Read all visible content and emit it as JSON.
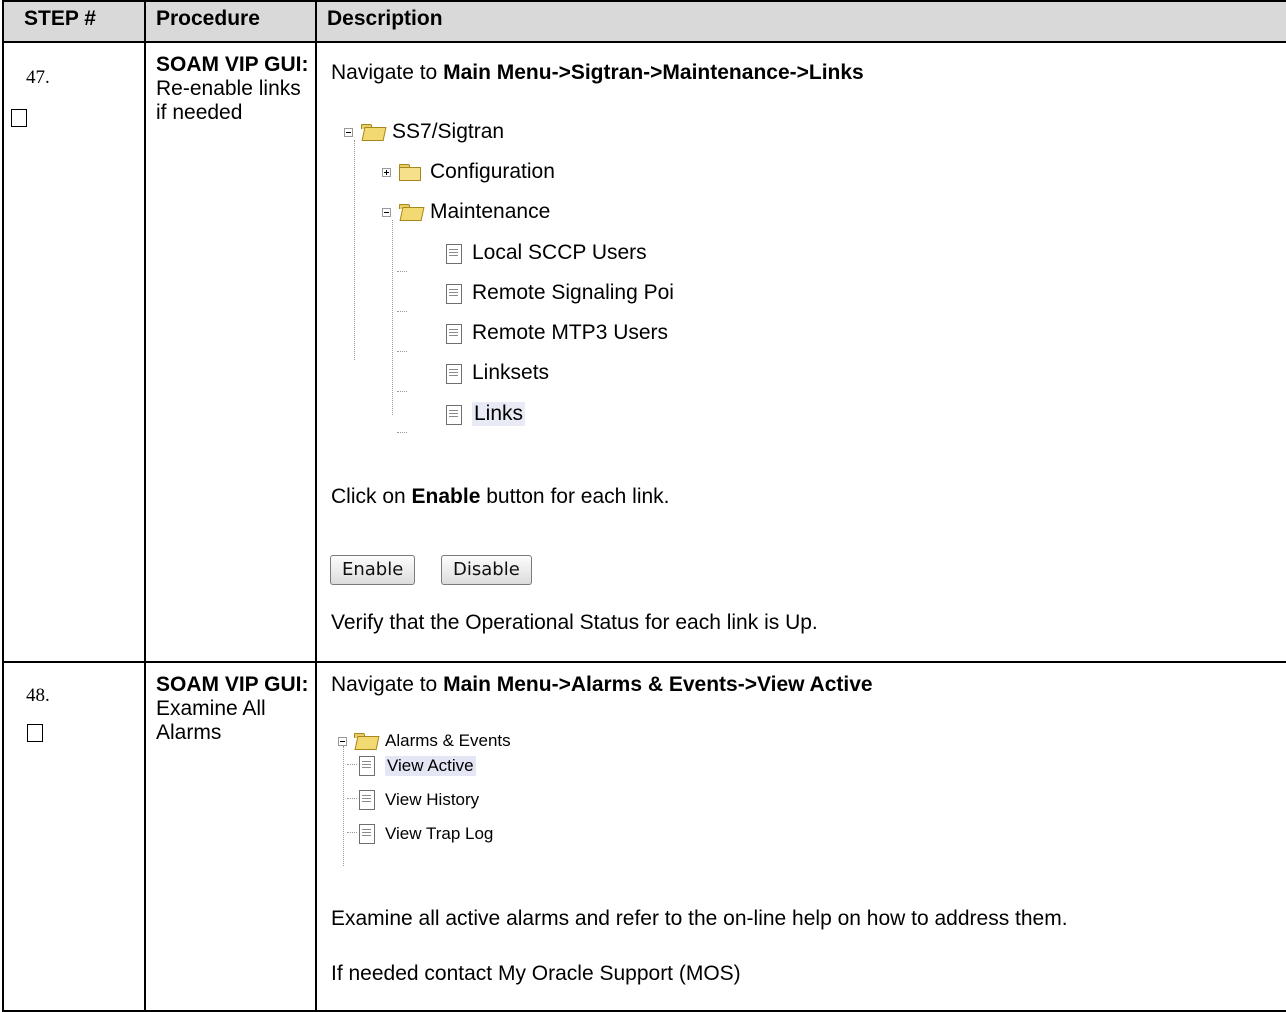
{
  "headers": {
    "step": "STEP #",
    "procedure": "Procedure",
    "description": "Description"
  },
  "step47": {
    "number": "47.",
    "procedure_bold": "SOAM VIP GUI:",
    "procedure_text": "Re-enable links if needed",
    "nav_prefix": "Navigate to ",
    "nav_path": "Main Menu->Sigtran->Maintenance->Links",
    "tree": {
      "root": "SS7/Sigtran",
      "configuration": "Configuration",
      "maintenance": "Maintenance",
      "items": [
        "Local SCCP Users",
        "Remote Signaling Poi",
        "Remote MTP3 Users",
        "Linksets",
        "Links"
      ]
    },
    "click_prefix": "Click on ",
    "click_bold": "Enable",
    "click_suffix": " button for each link.",
    "enable_button": "Enable",
    "disable_button": "Disable",
    "verify_text": "Verify that the Operational Status for each link is Up."
  },
  "step48": {
    "number": "48.",
    "procedure_bold": "SOAM VIP GUI:",
    "procedure_text": "Examine All Alarms",
    "nav_prefix": "Navigate to ",
    "nav_path": "Main Menu->Alarms & Events->View Active",
    "tree": {
      "root": "Alarms & Events",
      "items": [
        "View Active",
        "View History",
        "View Trap Log"
      ]
    },
    "examine_text": "Examine all active alarms and refer to the on-line help on how to address them.",
    "contact_text": "If needed contact My Oracle Support (MOS)"
  }
}
